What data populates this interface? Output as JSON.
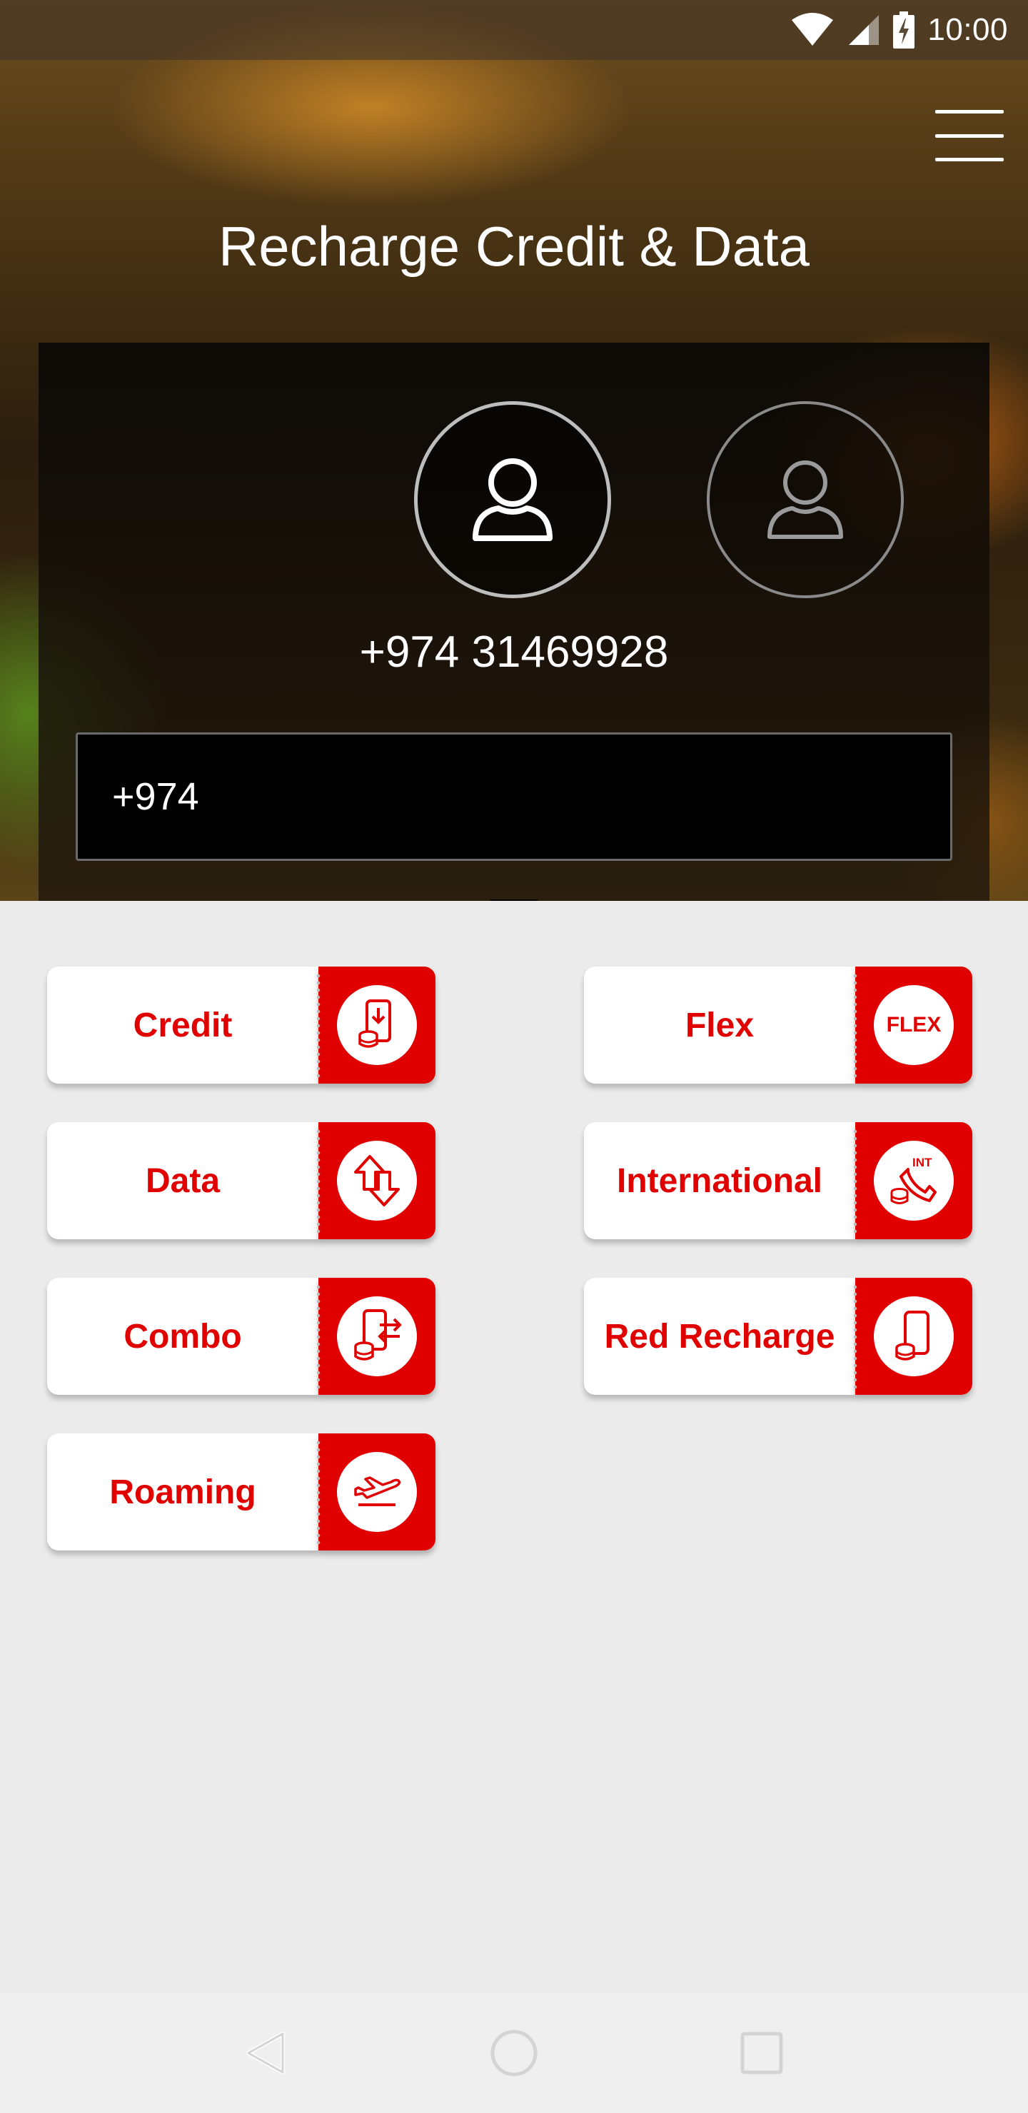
{
  "status_bar": {
    "time": "10:00"
  },
  "header": {
    "title": "Recharge Credit & Data"
  },
  "panel": {
    "selected_number": "+974 31469928",
    "input_value": "+974"
  },
  "options": [
    {
      "label": "Credit",
      "icon": "phone-coins-download-icon"
    },
    {
      "label": "Flex",
      "icon": "flex-badge-icon"
    },
    {
      "label": "Data",
      "icon": "data-transfer-arrows-icon"
    },
    {
      "label": "International",
      "icon": "international-call-icon"
    },
    {
      "label": "Combo",
      "icon": "combo-phone-coins-icon"
    },
    {
      "label": "Red Recharge",
      "icon": "red-recharge-phone-icon"
    },
    {
      "label": "Roaming",
      "icon": "airplane-takeoff-icon"
    }
  ],
  "flex_icon_text": "FLEX",
  "intl_icon_text": "INT",
  "colors": {
    "accent": "#e00000",
    "background": "#ebebeb"
  },
  "nav": {
    "back": "back-icon",
    "home": "home-icon",
    "recents": "recents-icon"
  }
}
